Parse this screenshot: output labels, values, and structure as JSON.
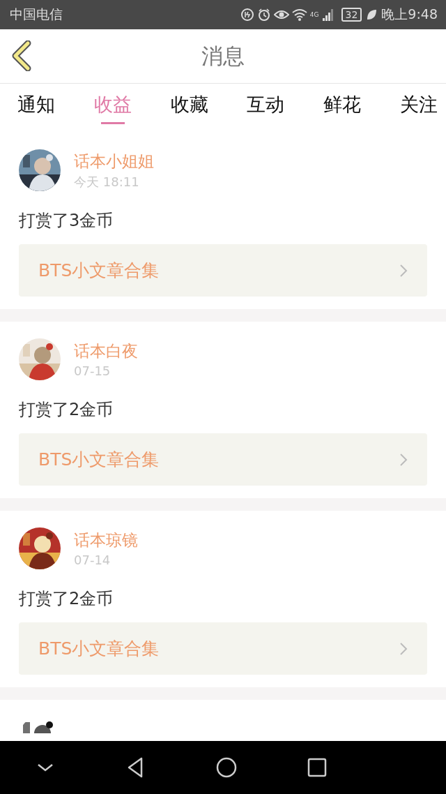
{
  "status_bar": {
    "carrier": "中国电信",
    "network": "4G",
    "battery": "32",
    "time": "晚上9:48"
  },
  "header": {
    "title": "消息"
  },
  "tabs": [
    {
      "label": "通知",
      "selected": false
    },
    {
      "label": "收益",
      "selected": true
    },
    {
      "label": "收藏",
      "selected": false
    },
    {
      "label": "互动",
      "selected": false
    },
    {
      "label": "鲜花",
      "selected": false
    },
    {
      "label": "关注",
      "selected": false
    }
  ],
  "messages": [
    {
      "user": "话本小姐姐",
      "time": "今天 18:11",
      "text": "打赏了3金币",
      "link": "BTS小文章合集",
      "avatar": {
        "kind": "picture"
      }
    },
    {
      "user": "话本白夜",
      "time": "07-15",
      "text": "打赏了2金币",
      "link": "BTS小文章合集",
      "avatar": {
        "kind": "picture"
      }
    },
    {
      "user": "话本琼镜",
      "time": "07-14",
      "text": "打赏了2金币",
      "link": "BTS小文章合集",
      "avatar": {
        "kind": "picture"
      }
    },
    {
      "avatar": {
        "kind": "picture"
      }
    }
  ]
}
